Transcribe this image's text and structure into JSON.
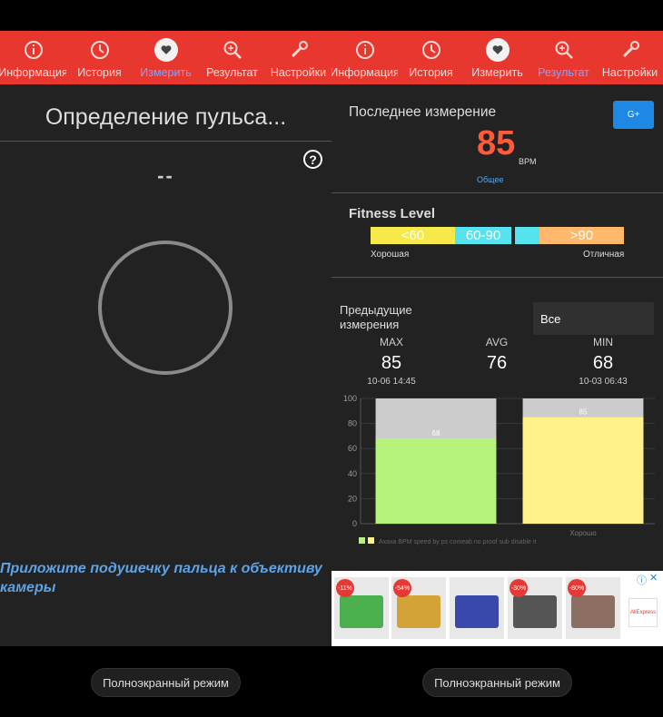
{
  "nav": [
    {
      "label": "Информация",
      "icon": "info-icon"
    },
    {
      "label": "История",
      "icon": "history-icon"
    },
    {
      "label": "Измерить",
      "icon": "heart-icon"
    },
    {
      "label": "Результат",
      "icon": "result-search-icon"
    },
    {
      "label": "Настройки",
      "icon": "wrench-icon"
    }
  ],
  "left": {
    "active_tab": 2,
    "title": "Определение пульса...",
    "pulse_placeholder": "--",
    "instruction": "Приложите подушечку пальца к объективу камеры",
    "fullscreen_button": "Полноэкранный режим"
  },
  "right": {
    "active_tab": 3,
    "last_measurement_label": "Последнее измерение",
    "share_button": "G+",
    "bpm_value": "85",
    "bpm_unit": "BPM",
    "status": "Общее",
    "fitness_level_label": "Fitness Level",
    "fitness": {
      "segments": [
        {
          "label": "<60",
          "color": "#f7e94a"
        },
        {
          "label": "60-90",
          "color": "#55e3ef"
        },
        {
          "label": "",
          "color": "#55e3ef"
        },
        {
          "label": ">90",
          "color": "#ffb86c"
        }
      ],
      "left_caption": "Хорошая",
      "right_caption": "Отличная"
    },
    "previous_label": "Предыдущие измерения",
    "filter_value": "Все",
    "stats": {
      "max_label": "MAX",
      "max_value": "85",
      "max_time": "10-06 14:45",
      "avg_label": "AVG",
      "avg_value": "76",
      "min_label": "MIN",
      "min_value": "68",
      "min_time": "10-03 06:43"
    },
    "fullscreen_button": "Полноэкранный режим",
    "ad": {
      "badges": [
        "-11%",
        "-54%",
        "",
        "-30%",
        "-80%"
      ],
      "logo": "AliExpress",
      "info_icon": "info-icon",
      "close_icon": "close-icon"
    }
  },
  "chart_data": {
    "type": "bar",
    "categories": [
      "",
      "Хорошо"
    ],
    "values": [
      68,
      85
    ],
    "ylim": [
      0,
      100
    ],
    "yticks": [
      0,
      20,
      40,
      60,
      80,
      100
    ],
    "colors": [
      "#b6f27a",
      "#fff28a"
    ],
    "background_color": "#cccccc",
    "legend_labels": [
      "",
      "Ахаха BPM speed by ps comeab no proof sub disable it"
    ],
    "grid": true
  }
}
